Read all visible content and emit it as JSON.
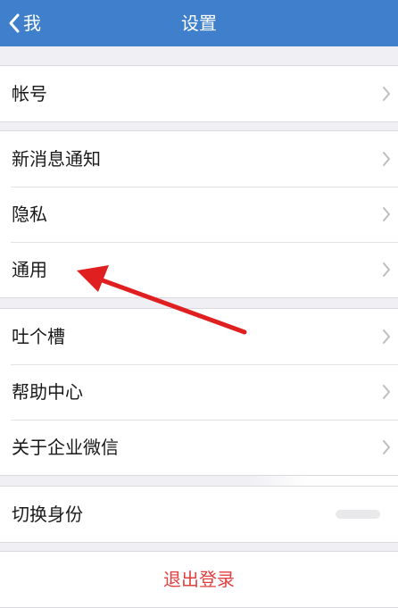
{
  "nav": {
    "back_label": "我",
    "title": "设置",
    "background_color": "#3f7fcb"
  },
  "groups": [
    {
      "items": [
        {
          "label": "帐号"
        }
      ]
    },
    {
      "items": [
        {
          "label": "新消息通知"
        },
        {
          "label": "隐私"
        },
        {
          "label": "通用"
        }
      ]
    },
    {
      "items": [
        {
          "label": "吐个槽"
        },
        {
          "label": "帮助中心"
        },
        {
          "label": "关于企业微信"
        }
      ]
    },
    {
      "items": [
        {
          "label": "切换身份"
        }
      ]
    }
  ],
  "logout": {
    "label": "退出登录",
    "color": "#e04040"
  },
  "annotation": {
    "icon": "red-arrow-icon",
    "color": "#e02020",
    "points_to": "通用"
  }
}
